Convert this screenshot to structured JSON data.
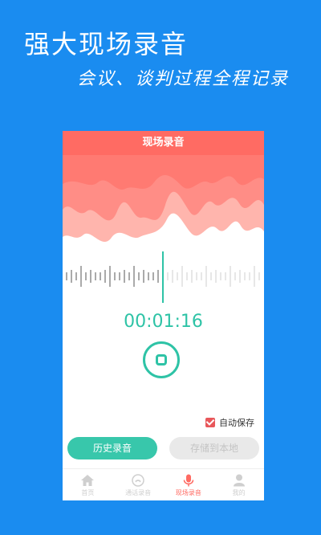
{
  "promo": {
    "title": "强大现场录音",
    "subtitle": "会议、谈判过程全程记录"
  },
  "header": {
    "title": "现场录音"
  },
  "timer": {
    "value": "00:01:16"
  },
  "autosave": {
    "label": "自动保存",
    "checked": true
  },
  "buttons": {
    "history": "历史录音",
    "save_local": "存储到本地"
  },
  "nav": {
    "items": [
      {
        "label": "首页",
        "icon": "home-icon"
      },
      {
        "label": "通话录音",
        "icon": "phone-icon"
      },
      {
        "label": "现场录音",
        "icon": "microphone-icon",
        "active": true
      },
      {
        "label": "我的",
        "icon": "user-icon"
      }
    ]
  },
  "colors": {
    "background": "#1a8cf0",
    "header": "#ff6b63",
    "accent": "#2ec3a6",
    "active_nav": "#ff6b63",
    "checkbox": "#e8575a"
  }
}
